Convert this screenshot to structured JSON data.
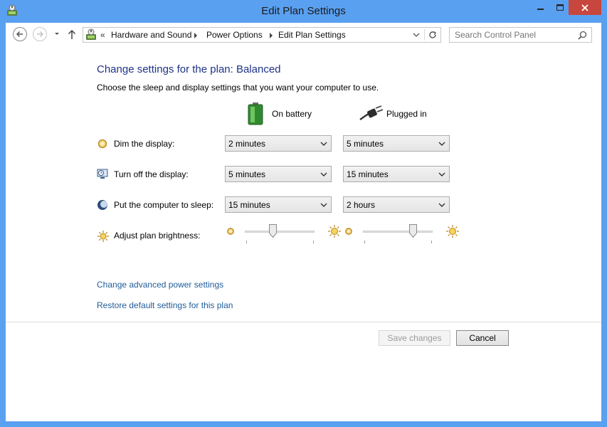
{
  "window": {
    "title": "Edit Plan Settings",
    "icons": {
      "app": "power-options-icon",
      "minimize": "minimize-icon",
      "maximize": "maximize-icon",
      "close": "close-icon"
    },
    "accent_color": "#5aa0f0",
    "close_color": "#c7463d"
  },
  "nav": {
    "back_icon": "back-arrow-icon",
    "forward_icon": "forward-arrow-icon",
    "recent_icon": "chevron-down-icon",
    "up_icon": "up-arrow-icon",
    "address": {
      "overflow": "«",
      "breadcrumbs": [
        "Hardware and Sound",
        "Power Options",
        "Edit Plan Settings"
      ]
    },
    "search": {
      "placeholder": "Search Control Panel"
    }
  },
  "main": {
    "heading": "Change settings for the plan: Balanced",
    "subheading": "Choose the sleep and display settings that you want your computer to use.",
    "columns": [
      {
        "label": "On battery",
        "icon": "battery-icon"
      },
      {
        "label": "Plugged in",
        "icon": "power-plug-icon"
      }
    ],
    "settings": [
      {
        "label": "Dim the display:",
        "icon": "dim-display-icon",
        "on_battery": "2 minutes",
        "plugged_in": "5 minutes"
      },
      {
        "label": "Turn off the display:",
        "icon": "display-timer-icon",
        "on_battery": "5 minutes",
        "plugged_in": "15 minutes"
      },
      {
        "label": "Put the computer to sleep:",
        "icon": "sleep-moon-icon",
        "on_battery": "15 minutes",
        "plugged_in": "2 hours"
      }
    ],
    "brightness": {
      "label": "Adjust plan brightness:",
      "icon": "brightness-icon",
      "on_battery_level": 0.4,
      "plugged_in_level": 0.72
    },
    "links": {
      "advanced": "Change advanced power settings",
      "restore": "Restore default settings for this plan"
    }
  },
  "footer": {
    "save_label": "Save changes",
    "cancel_label": "Cancel"
  }
}
